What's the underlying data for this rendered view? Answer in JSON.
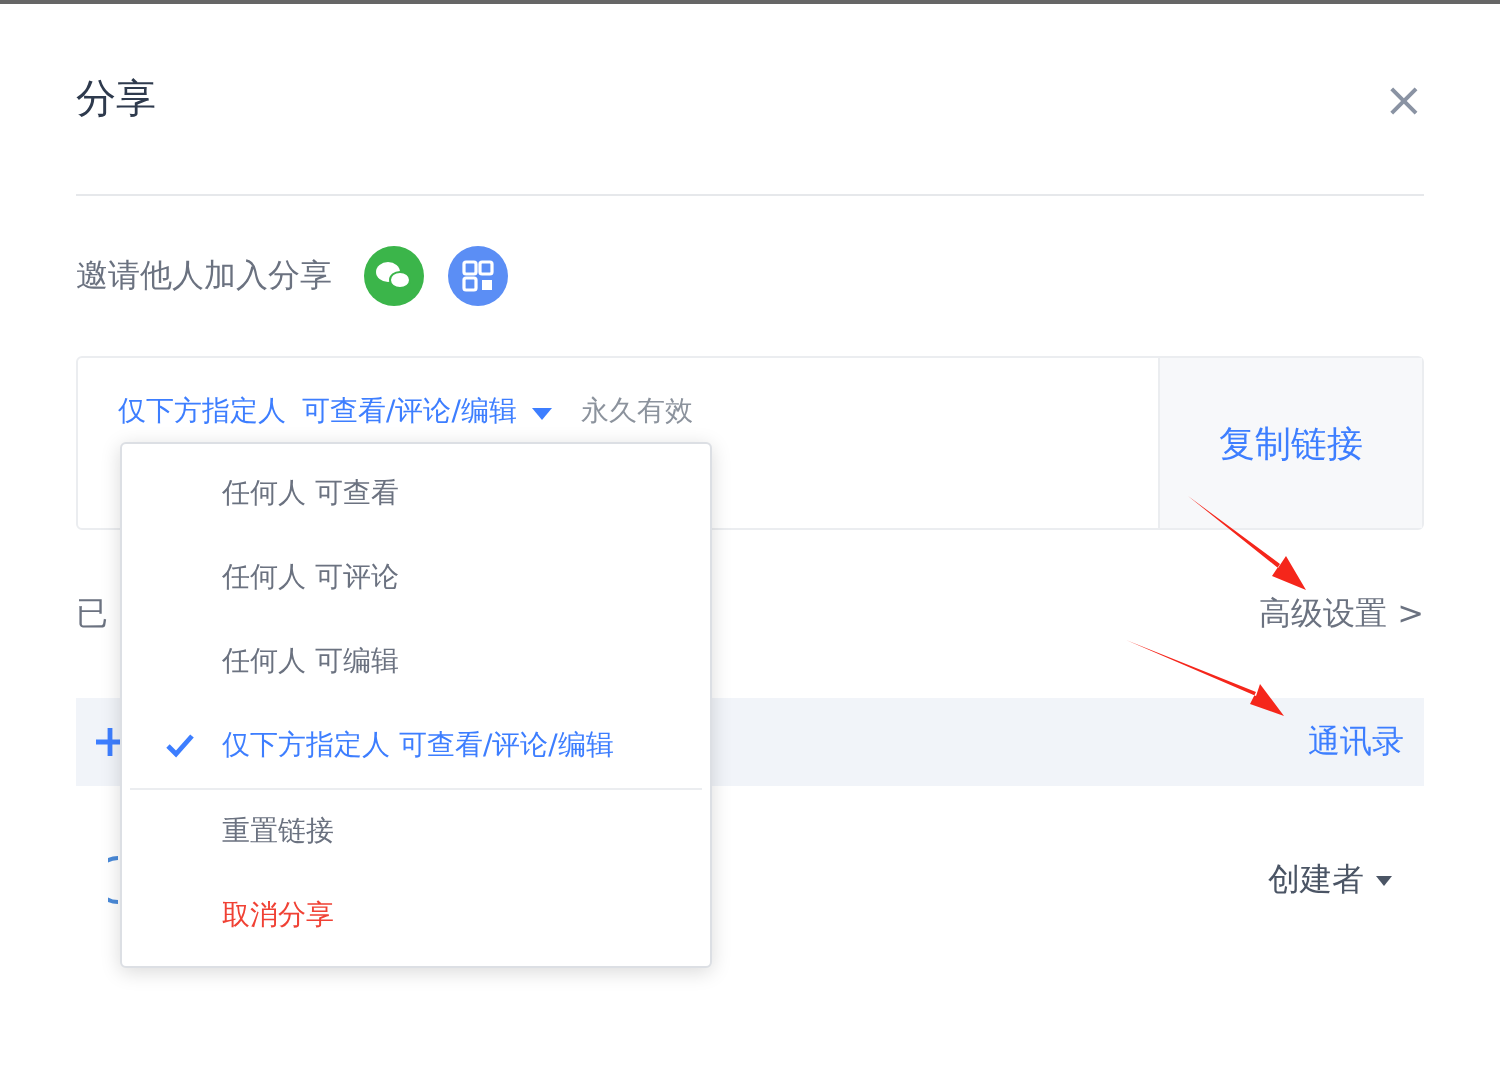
{
  "dialog": {
    "title": "分享",
    "close": "×"
  },
  "invite": {
    "label": "邀请他人加入分享"
  },
  "link": {
    "scope": "仅下方指定人",
    "permission": "可查看/评论/编辑",
    "validity": "永久有效",
    "copy_button": "复制链接"
  },
  "menu": {
    "items": [
      {
        "kind": "option",
        "label": "任何人 可查看",
        "selected": false
      },
      {
        "kind": "option",
        "label": "任何人 可评论",
        "selected": false
      },
      {
        "kind": "option",
        "label": "任何人 可编辑",
        "selected": false
      },
      {
        "kind": "option",
        "label": "仅下方指定人 可查看/评论/编辑",
        "selected": true
      },
      {
        "kind": "action",
        "label": "重置链接"
      },
      {
        "kind": "danger",
        "label": "取消分享"
      }
    ]
  },
  "members": {
    "heading": "已",
    "advanced": "高级设置 >",
    "contacts": "通讯录",
    "role": "创建者"
  }
}
